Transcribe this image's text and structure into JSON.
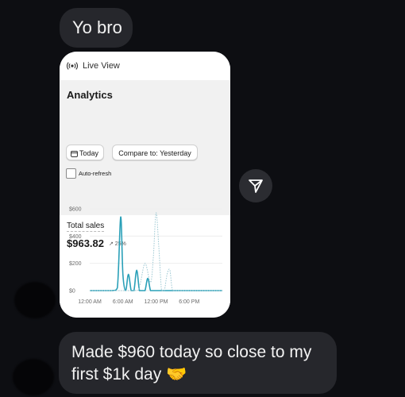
{
  "messages": {
    "first": "Yo bro",
    "last": "Made $960 today so close to my first $1k day 🤝"
  },
  "card": {
    "live_label": "Live View",
    "title": "Analytics",
    "today_label": "Today",
    "compare_label": "Compare to: Yesterday",
    "auto_refresh_label": "Auto-refresh",
    "total_sales_label": "Total sales",
    "sales_value": "$963.82",
    "sales_change": "↗ 25%"
  },
  "icons": {
    "share": "paper-plane-icon",
    "live": "broadcast-icon",
    "calendar": "calendar-icon"
  },
  "colors": {
    "accent": "#2aa0b8",
    "bubble": "#26272c",
    "background": "#0d0e12"
  },
  "chart_data": {
    "type": "line",
    "x_ticks": [
      "12:00 AM",
      "6:00 AM",
      "12:00 PM",
      "6:00 PM"
    ],
    "y_ticks": [
      "$600",
      "$400",
      "$200",
      "$0"
    ],
    "ylim": [
      0,
      600
    ],
    "x_range_hours": [
      0,
      24
    ],
    "series": [
      {
        "style": "solid",
        "x": [
          0,
          4,
          5,
          5.6,
          6,
          6.5,
          7,
          7.5,
          8,
          8.5,
          9,
          9.5,
          10,
          10.5,
          11,
          11.5,
          12,
          12.5,
          13,
          14,
          15,
          24
        ],
        "y": [
          0,
          0,
          20,
          540,
          120,
          0,
          120,
          0,
          0,
          150,
          0,
          0,
          0,
          90,
          0,
          0,
          0,
          0,
          0,
          0,
          0,
          0
        ]
      },
      {
        "style": "dotted",
        "x": [
          0,
          8,
          9,
          10,
          11,
          11.5,
          12,
          12.5,
          13,
          13.5,
          14,
          14.5,
          15,
          16,
          24
        ],
        "y": [
          0,
          0,
          30,
          200,
          60,
          240,
          570,
          320,
          0,
          0,
          120,
          150,
          0,
          0,
          0
        ]
      }
    ]
  }
}
